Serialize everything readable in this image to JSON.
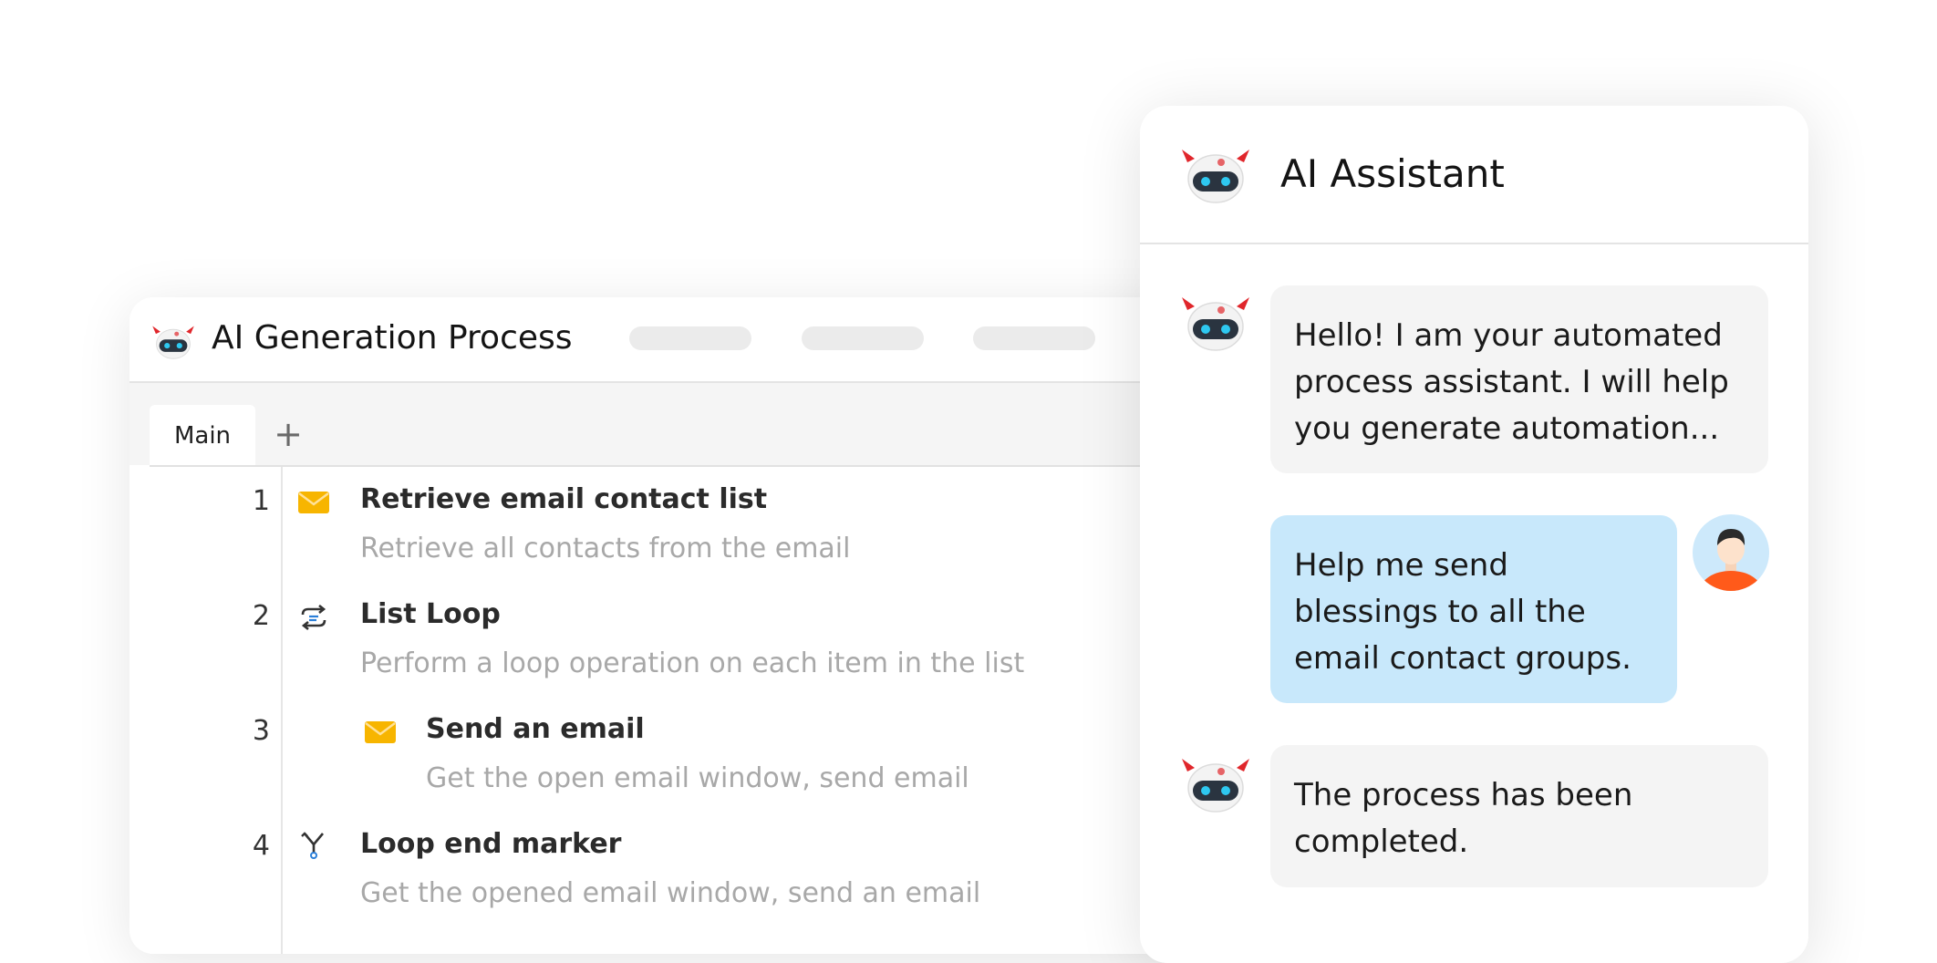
{
  "process_window": {
    "title": "AI Generation Process",
    "tabs": [
      {
        "label": "Main"
      }
    ],
    "add_tab_label": "+",
    "steps": [
      {
        "number": "1",
        "icon": "email-icon",
        "title": "Retrieve email contact list",
        "description": "Retrieve all contacts from the email"
      },
      {
        "number": "2",
        "icon": "loop-icon",
        "title": "List Loop",
        "description": "Perform a loop operation on each item in the list"
      },
      {
        "number": "3",
        "icon": "email-icon",
        "title": "Send an email",
        "description": "Get the open email window, send email"
      },
      {
        "number": "4",
        "icon": "loop-end-icon",
        "title": "Loop end marker",
        "description": "Get the opened email window, send an email"
      }
    ]
  },
  "assistant": {
    "title": "AI Assistant",
    "messages": [
      {
        "role": "bot",
        "text": "Hello! I am your automated process assistant. I will help you generate automation..."
      },
      {
        "role": "user",
        "text": "Help me send blessings to all the email contact groups."
      },
      {
        "role": "bot",
        "text": "The process has been completed."
      }
    ]
  },
  "colors": {
    "user_bubble": "#c8e8fb",
    "bot_bubble": "#f4f4f4",
    "robot_horn": "#e0262b",
    "robot_visor": "#2a3440",
    "robot_eye": "#2ec8f0",
    "email_icon": "#f7b500",
    "loop_icon_accent": "#2b7fd8",
    "user_shirt": "#ff5a1a",
    "user_avatar_bg": "#cde9fb"
  }
}
